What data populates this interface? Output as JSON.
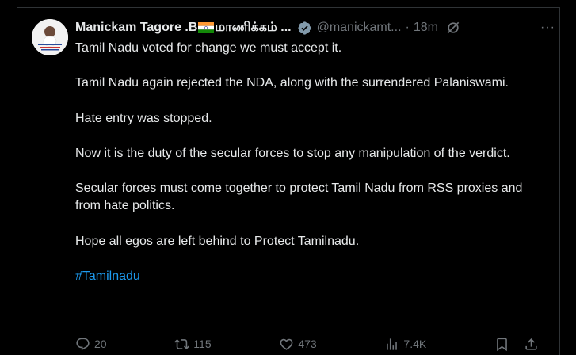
{
  "tweet": {
    "display_name": "Manickam Tagore .B",
    "display_name_suffix": "மாணிக்கம் ...",
    "handle": "@manickamt...",
    "separator": "·",
    "time": "18m",
    "more": "···",
    "paragraphs": [
      "Tamil Nadu voted for change we must accept it.",
      "Tamil Nadu again rejected the NDA, along with the surrendered Palaniswami.",
      "Hate entry was stopped.",
      "Now it is the duty of the secular forces to stop any manipulation of the verdict.",
      "Secular forces must come together to protect Tamil Nadu from RSS proxies and from hate politics.",
      "Hope all egos are left behind to Protect Tamilnadu."
    ],
    "hashtag": "#Tamilnadu",
    "stats": {
      "replies": "20",
      "reposts": "115",
      "likes": "473",
      "views": "7.4K"
    }
  },
  "colors": {
    "background": "#000000",
    "text": "#e7e9ea",
    "muted": "#71767b",
    "link": "#1d9bf0"
  }
}
